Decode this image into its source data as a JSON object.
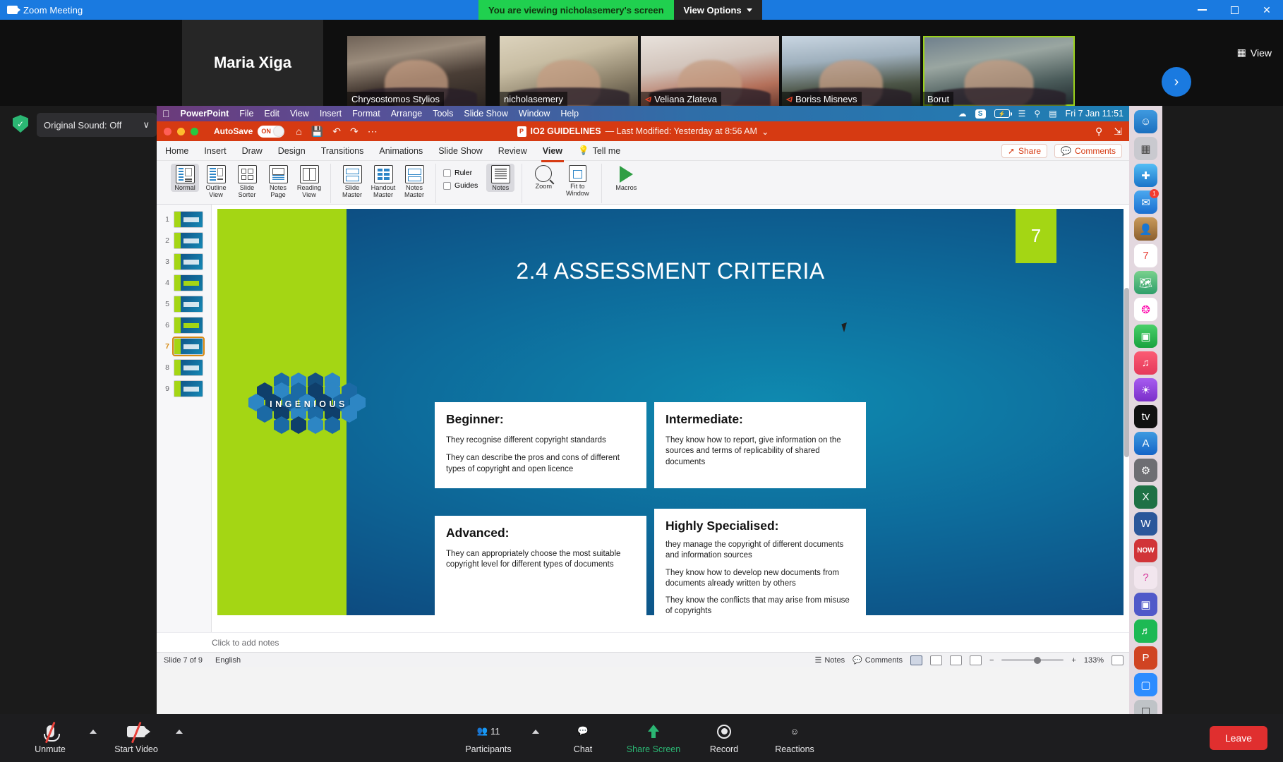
{
  "zoom_window": {
    "title": "Zoom Meeting",
    "sharing_banner": "You are viewing nicholasemery's screen",
    "view_options": "View Options",
    "view_button": "View",
    "next_arrow": "›",
    "window_controls": {
      "minimize": "–",
      "maximize": "□",
      "close": "✕"
    }
  },
  "self_view": {
    "name": "Maria Xiga"
  },
  "participants_strip": [
    {
      "name": "Maria Xiga",
      "muted": true
    },
    {
      "name": "Chrysostomos Stylios",
      "muted": false
    },
    {
      "name": "nicholasemery",
      "muted": false
    },
    {
      "name": "Veliana Zlateva",
      "muted": true
    },
    {
      "name": "Boriss Misnevs",
      "muted": true
    },
    {
      "name": "Borut",
      "muted": false
    }
  ],
  "audio_chip": {
    "label": "Original Sound: Off",
    "chevron": "∨",
    "shield_icon": "shield-check-icon"
  },
  "shared_screen": {
    "mac_menubar": {
      "apple": "",
      "app": "PowerPoint",
      "menus": [
        "File",
        "Edit",
        "View",
        "Insert",
        "Format",
        "Arrange",
        "Tools",
        "Slide Show",
        "Window",
        "Help"
      ],
      "status_icons": [
        "cloud-icon",
        "security-badge-icon",
        "battery-charging-icon",
        "wifi-icon",
        "search-icon",
        "control-center-icon"
      ],
      "clock": "Fri 7 Jan  11:51"
    },
    "powerpoint": {
      "titlebar": {
        "autosave_label": "AutoSave",
        "autosave_state": "ON",
        "document_title": "IO2 GUIDELINES",
        "modified_text": "— Last Modified: Yesterday at 8:56 AM",
        "quick_icons": [
          "home-icon",
          "save-icon",
          "undo-icon",
          "redo-icon",
          "more-icon"
        ],
        "right_icons": [
          "search-icon",
          "ribbon-display-icon"
        ]
      },
      "tabs": [
        "Home",
        "Insert",
        "Draw",
        "Design",
        "Transitions",
        "Animations",
        "Slide Show",
        "Review",
        "View"
      ],
      "active_tab": "View",
      "tell_me": "Tell me",
      "share_label": "Share",
      "comments_label": "Comments",
      "ribbon": {
        "presentation_views": [
          {
            "label": "Normal",
            "selected": true
          },
          {
            "label": "Outline View",
            "selected": false
          },
          {
            "label": "Slide Sorter",
            "selected": false
          },
          {
            "label": "Notes Page",
            "selected": false
          },
          {
            "label": "Reading View",
            "selected": false
          }
        ],
        "master_views": [
          {
            "label": "Slide Master"
          },
          {
            "label": "Handout Master"
          },
          {
            "label": "Notes Master"
          }
        ],
        "show": [
          {
            "label": "Ruler",
            "checked": false
          },
          {
            "label": "Guides",
            "checked": false
          }
        ],
        "notes_button": "Notes",
        "zoom_group": [
          {
            "label": "Zoom"
          },
          {
            "label": "Fit to Window"
          }
        ],
        "macros": "Macros"
      },
      "thumbnails": [
        {
          "number": "1"
        },
        {
          "number": "2"
        },
        {
          "number": "3"
        },
        {
          "number": "4"
        },
        {
          "number": "5"
        },
        {
          "number": "6"
        },
        {
          "number": "7",
          "selected": true
        },
        {
          "number": "8"
        },
        {
          "number": "9"
        }
      ],
      "notes_placeholder": "Click to add notes",
      "status_bar": {
        "slide_counter": "Slide 7 of 9",
        "language": "English",
        "notes_label": "Notes",
        "comments_label": "Comments",
        "zoom_level": "133%",
        "view_icons": [
          "normal-view-icon",
          "slide-sorter-icon",
          "reading-view-icon",
          "slideshow-icon"
        ],
        "zoom_out": "−",
        "zoom_in": "+",
        "fit_icon": "fit-slide-icon"
      }
    },
    "slide": {
      "number_chip": "7",
      "title": "2.4 ASSESSMENT CRITERIA",
      "logo_text": "INGENIOUS",
      "boxes": [
        {
          "heading": "Beginner:",
          "paragraphs": [
            "They recognise different copyright standards",
            "They can describe the pros and cons of different types of copyright and open licence"
          ]
        },
        {
          "heading": "Intermediate:",
          "paragraphs": [
            "They know how to report, give information on the sources and terms of replicability of shared documents"
          ]
        },
        {
          "heading": "Advanced:",
          "paragraphs": [
            "They can appropriately choose the most suitable copyright level for different types of documents"
          ]
        },
        {
          "heading": "Highly Specialised:",
          "paragraphs": [
            "they manage the copyright of different documents and information sources",
            "They know how to develop new documents from documents already written by others",
            "They know the conflicts that may arise from misuse of copyrights"
          ]
        }
      ]
    },
    "dock_apps": [
      "finder-icon",
      "launchpad-icon",
      "safari-icon",
      "mail-icon",
      "contacts-icon",
      "calendar-icon",
      "maps-icon",
      "photos-icon",
      "facetime-icon",
      "music-icon",
      "podcasts-icon",
      "appletv-icon",
      "appstore-icon",
      "settings-icon",
      "excel-icon",
      "word-icon",
      "now-icon",
      "help-icon",
      "teams-icon",
      "spotify-icon",
      "powerpoint-icon",
      "zoom-icon",
      "screenshot-icon",
      "trash-icon"
    ]
  },
  "zoom_toolbar": {
    "left": [
      {
        "label": "Unmute",
        "icon": "microphone-muted-icon",
        "has_caret": true
      },
      {
        "label": "Start Video",
        "icon": "camera-off-icon",
        "has_caret": true
      }
    ],
    "center": [
      {
        "label": "Participants",
        "icon": "participants-icon",
        "count": "11",
        "has_caret": true
      },
      {
        "label": "Chat",
        "icon": "chat-icon"
      },
      {
        "label": "Share Screen",
        "icon": "share-screen-icon",
        "highlight": true
      },
      {
        "label": "Record",
        "icon": "record-icon"
      },
      {
        "label": "Reactions",
        "icon": "reactions-icon"
      }
    ],
    "leave_label": "Leave"
  },
  "colors": {
    "zoom_blue": "#1a7ae0",
    "share_green": "#20d04f",
    "leave_red": "#e02f2f",
    "powerpoint_red": "#d63a12",
    "slide_green": "#a4d614",
    "slide_blue": "#0d6b9b"
  }
}
